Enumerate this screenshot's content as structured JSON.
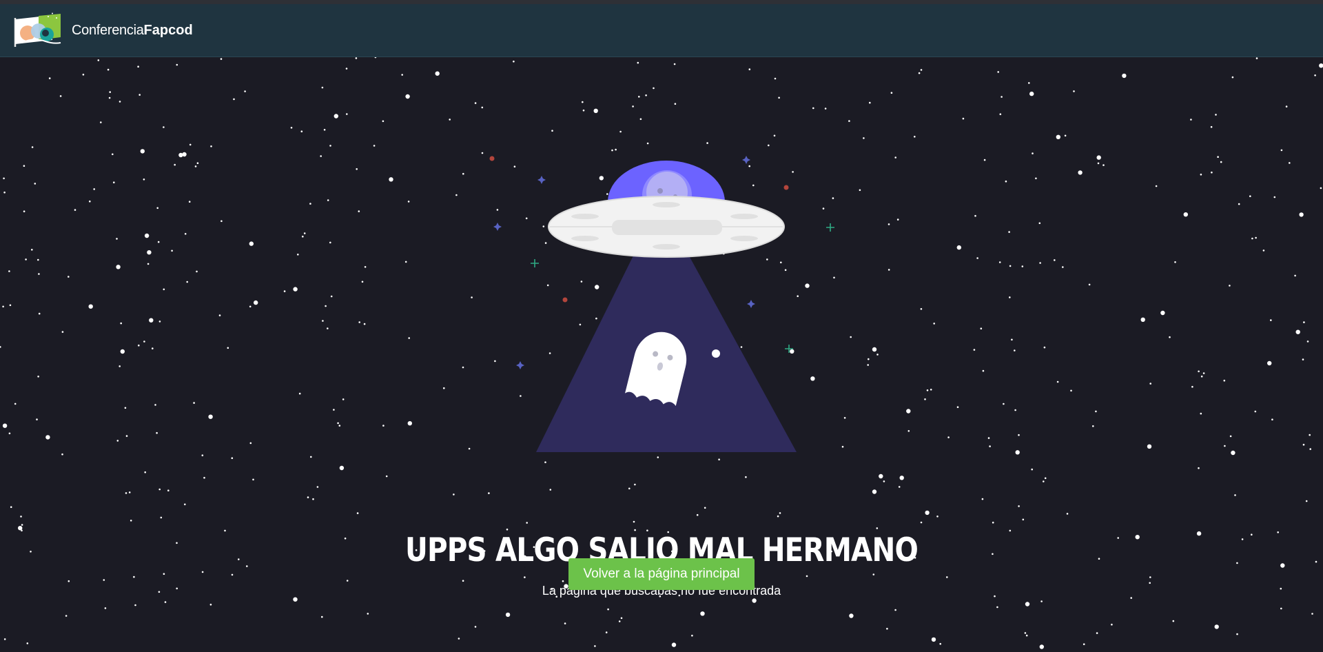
{
  "navbar": {
    "brand_light": "Conferencia",
    "brand_bold": "Fapcod",
    "logo_icon": "conference-flag-logo-icon"
  },
  "error_page": {
    "headline": "UPPS ALGO SALIO MAL HERMANO",
    "subtitle": "La pagina que buscabas no fue encontrada",
    "button_label": "Volver a la página principal"
  },
  "colors": {
    "navbar_bg": "#1f3440",
    "page_bg": "#1b1b24",
    "button_bg": "#6cc24a",
    "ufo_dome": "#6c63ff",
    "beam": "#2f2b5c"
  }
}
